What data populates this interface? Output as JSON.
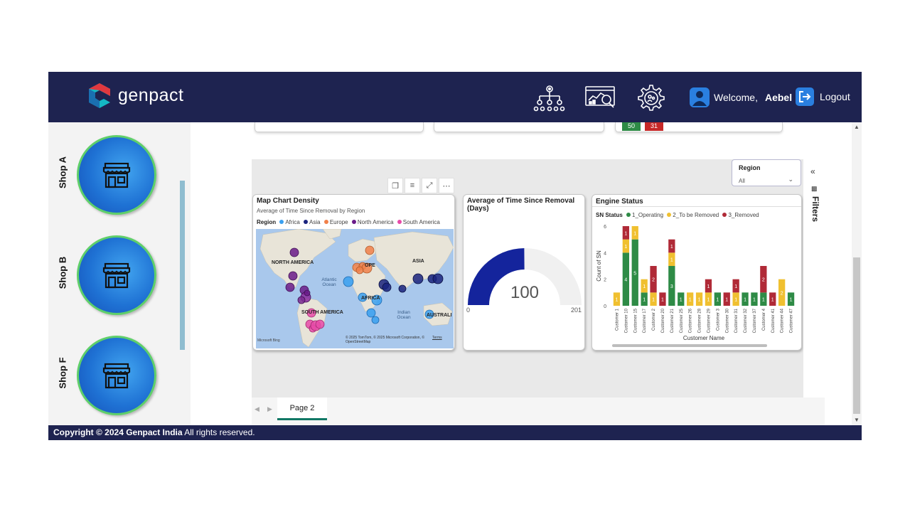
{
  "header": {
    "brand": "genpact",
    "welcome_label": "Welcome,",
    "user_name": "Aebel",
    "logout_label": "Logout",
    "icons": [
      "org-chart-icon",
      "dashboard-analysis-icon",
      "settings-gear-icon",
      "user-avatar-icon",
      "logout-icon"
    ],
    "colors": {
      "bar": "#1e2350",
      "brand_red": "#e0383f",
      "brand_teal": "#14b8c4"
    }
  },
  "sidebar": {
    "shops": [
      {
        "label": "Shop A",
        "icon": "storefront-icon"
      },
      {
        "label": "Shop B",
        "icon": "storefront-icon"
      },
      {
        "label": "Shop F",
        "icon": "storefront-icon"
      }
    ]
  },
  "top_badges": {
    "green": "50",
    "red": "31"
  },
  "slicer": {
    "label": "Region",
    "value": "All"
  },
  "map_visual": {
    "title": "Map Chart Density",
    "subtitle": "Average of Time Since Removal by Region",
    "legend_title": "Region",
    "legend": [
      {
        "name": "Africa",
        "color": "#3aa0f0"
      },
      {
        "name": "Asia",
        "color": "#1a237e"
      },
      {
        "name": "Europe",
        "color": "#f0804a"
      },
      {
        "name": "North America",
        "color": "#6a1b8a"
      },
      {
        "name": "South America",
        "color": "#e84aa8"
      }
    ],
    "labels": {
      "north_america": "NORTH AMERICA",
      "europe": "OPE",
      "asia": "ASIA",
      "africa": "AFRICA",
      "south_america": "SOUTH AMERICA",
      "australia": "AUSTRALI",
      "atlantic": "Atlantic Ocean",
      "indian": "Indian Ocean"
    },
    "attribution": "© 2025 TomTom, © 2025 Microsoft Corporation, © OpenStreetMap",
    "terms": "Terms",
    "bing": "Microsoft Bing"
  },
  "gauge_visual": {
    "title": "Average of Time Since Removal (Days)",
    "value": 100,
    "min": 0,
    "max": 201,
    "value_label": "100",
    "min_label": "0",
    "max_label": "201",
    "fill_color": "#14249c"
  },
  "chart_data": {
    "type": "bar",
    "title": "Engine Status",
    "legend_title": "SN Status",
    "xlabel": "Customer Name",
    "ylabel": "Count of SN",
    "ylim": [
      0,
      6
    ],
    "yticks": [
      0,
      2,
      4,
      6
    ],
    "stacked": true,
    "categories": [
      "Customer 1",
      "Customer 10",
      "Customer 15",
      "Customer 17",
      "Customer 2",
      "Customer 20",
      "Customer 21",
      "Customer 25",
      "Customer 26",
      "Customer 28",
      "Customer 29",
      "Customer 3",
      "Customer 30",
      "Customer 31",
      "Customer 32",
      "Customer 37",
      "Customer 4",
      "Customer 41",
      "Customer 44",
      "Customer 47"
    ],
    "series": [
      {
        "name": "1_Operating",
        "color": "#2e8b46",
        "values": [
          0,
          4,
          5,
          1,
          0,
          0,
          3,
          1,
          0,
          0,
          0,
          1,
          0,
          0,
          1,
          1,
          1,
          0,
          0,
          1
        ]
      },
      {
        "name": "2_To be Removed",
        "color": "#f0c030",
        "values": [
          1,
          1,
          1,
          1,
          1,
          0,
          1,
          0,
          1,
          1,
          1,
          0,
          0,
          1,
          0,
          0,
          0,
          0,
          2,
          0
        ]
      },
      {
        "name": "3_Removed",
        "color": "#b02a37",
        "values": [
          0,
          1,
          0,
          0,
          2,
          1,
          1,
          0,
          0,
          0,
          1,
          0,
          1,
          1,
          0,
          0,
          2,
          1,
          0,
          0
        ]
      }
    ]
  },
  "filters_pane": {
    "label": "Filters"
  },
  "pages": {
    "tab": "Page 2"
  },
  "footer": {
    "copyright": "Copyright © 2024 Genpact India",
    "rights": " All rights reserved."
  }
}
